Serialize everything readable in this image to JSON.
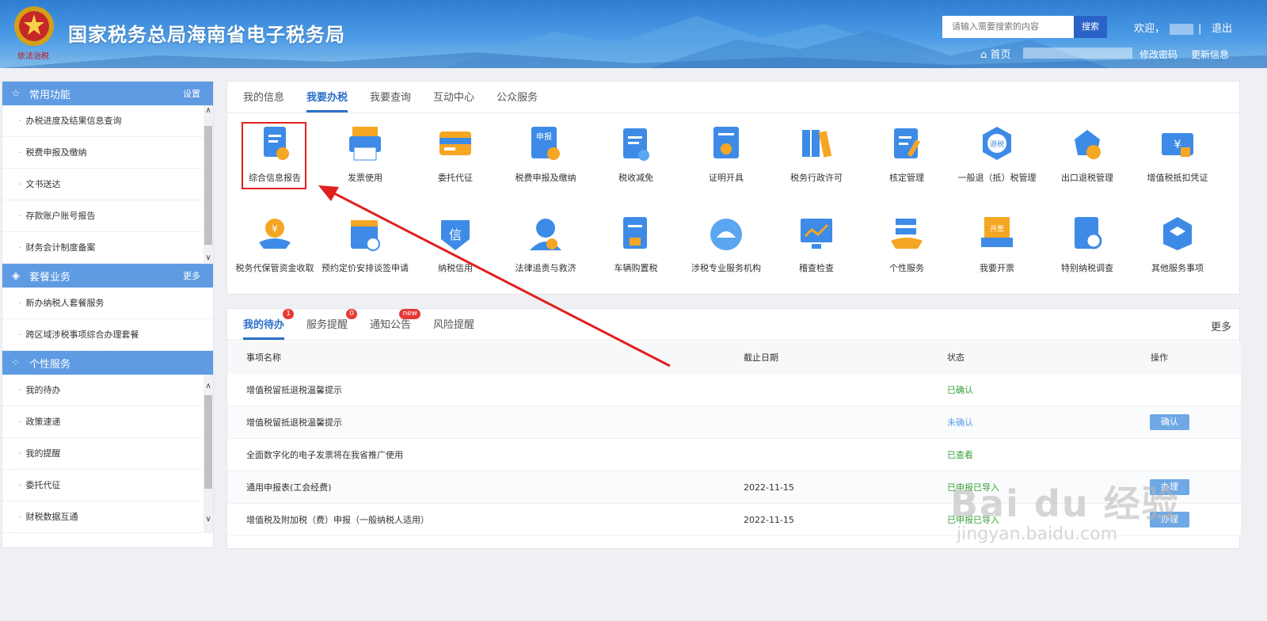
{
  "header": {
    "title": "国家税务总局海南省电子税务局",
    "motto": "依法治税",
    "search_placeholder": "请输入需要搜索的内容",
    "search_button": "搜索",
    "welcome": "欢迎，",
    "logout": "退出",
    "home": "首页",
    "change_password": "修改密码",
    "update_info": "更新信息"
  },
  "sidebar": {
    "common": {
      "title": "常用功能",
      "action": "设置",
      "items": [
        "办税进度及结果信息查询",
        "税费申报及缴纳",
        "文书送达",
        "存款账户账号报告",
        "财务会计制度备案"
      ]
    },
    "package": {
      "title": "套餐业务",
      "action": "更多",
      "items": [
        "新办纳税人套餐服务",
        "跨区域涉税事项综合办理套餐"
      ]
    },
    "personal": {
      "title": "个性服务",
      "items": [
        "我的待办",
        "政策速递",
        "我的提醒",
        "委托代征",
        "财税数据互通"
      ]
    }
  },
  "main_tabs": [
    "我的信息",
    "我要办税",
    "我要查询",
    "互动中心",
    "公众服务"
  ],
  "services": [
    "综合信息报告",
    "发票使用",
    "委托代征",
    "税费申报及缴纳",
    "税收减免",
    "证明开具",
    "税务行政许可",
    "核定管理",
    "一般退（抵）税管理",
    "出口退税管理",
    "增值税抵扣凭证",
    "税务代保管资金收取",
    "预约定价安排谈签申请",
    "纳税信用",
    "法律追责与救济",
    "车辆购置税",
    "涉税专业服务机构",
    "稽查检查",
    "个性服务",
    "我要开票",
    "特别纳税调查",
    "其他服务事项"
  ],
  "service_icon_texts": {
    "declare": "申报",
    "refund": "退税",
    "credit": "信",
    "invoice": "开票",
    "yuan": "¥"
  },
  "todo": {
    "tabs": [
      {
        "label": "我的待办",
        "badge": "1"
      },
      {
        "label": "服务提醒",
        "badge": "0"
      },
      {
        "label": "通知公告",
        "badge": "new"
      },
      {
        "label": "风险提醒",
        "badge": ""
      }
    ],
    "more": "更多",
    "columns": [
      "事项名称",
      "截止日期",
      "状态",
      "操作"
    ],
    "rows": [
      {
        "name": "增值税留抵退税温馨提示",
        "date": "",
        "status": "已确认",
        "op": ""
      },
      {
        "name": "增值税留抵退税温馨提示",
        "date": "",
        "status": "未确认",
        "op": "确认"
      },
      {
        "name": "全面数字化的电子发票将在我省推广使用",
        "date": "",
        "status": "已查看",
        "op": ""
      },
      {
        "name": "通用申报表(工会经费)",
        "date": "2022-11-15",
        "status": "已申报已导入",
        "op": "办理"
      },
      {
        "name": "增值税及附加税（费）申报（一般纳税人适用）",
        "date": "2022-11-15",
        "status": "已申报已导入",
        "op": "办理"
      }
    ]
  },
  "watermark": {
    "brand": "Bai  du 经验",
    "url": "jingyan.baidu.com"
  },
  "colors": {
    "accent": "#2d6ec9",
    "sidebar_head": "#5e9be2",
    "highlight": "#e02020",
    "ok": "#3aa13a",
    "pending": "#5d9ee8"
  }
}
